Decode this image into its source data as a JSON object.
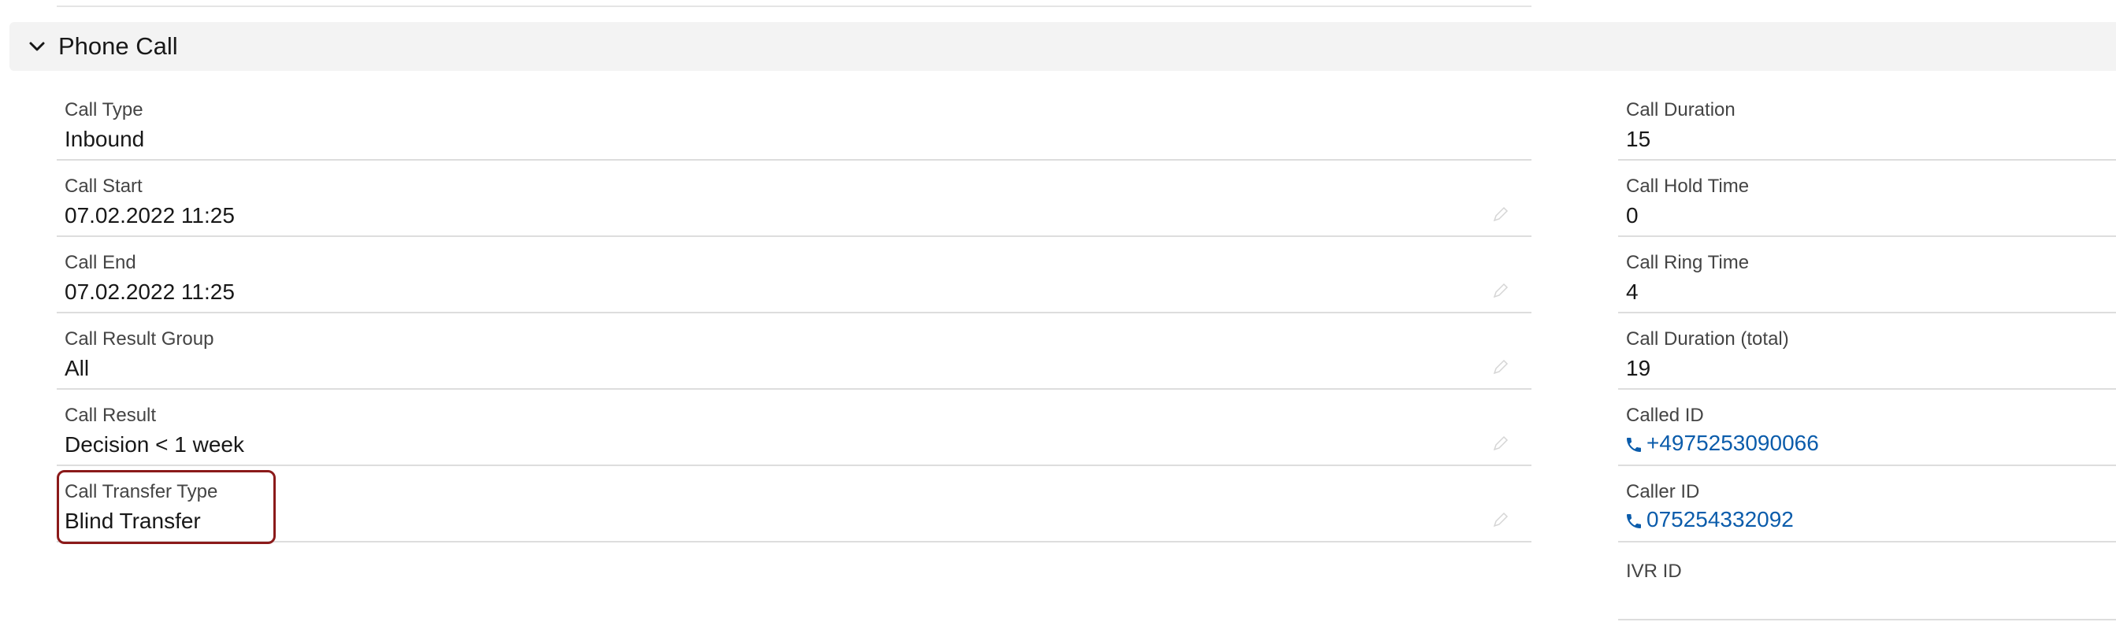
{
  "section": {
    "title": "Phone Call",
    "icon": "chevron-down-icon"
  },
  "left_fields": [
    {
      "label": "Call Type",
      "value": "Inbound",
      "editable": false
    },
    {
      "label": "Call Start",
      "value": "07.02.2022 11:25",
      "editable": true
    },
    {
      "label": "Call End",
      "value": "07.02.2022 11:25",
      "editable": true
    },
    {
      "label": "Call Result Group",
      "value": "All",
      "editable": true
    },
    {
      "label": "Call Result",
      "value": "Decision < 1 week",
      "editable": true
    },
    {
      "label": "Call Transfer Type",
      "value": "Blind Transfer",
      "editable": true
    }
  ],
  "right_fields": [
    {
      "label": "Call Duration",
      "value": "15"
    },
    {
      "label": "Call Hold Time",
      "value": "0"
    },
    {
      "label": "Call Ring Time",
      "value": "4"
    },
    {
      "label": "Call Duration (total)",
      "value": "19"
    },
    {
      "label": "Called ID",
      "value": "+4975253090066",
      "link": true
    },
    {
      "label": "Caller ID",
      "value": "075254332092",
      "link": true
    },
    {
      "label": "IVR ID",
      "value": ""
    }
  ],
  "colors": {
    "link": "#0b5cab",
    "highlight": "#8b1a1a",
    "header_bg": "#f3f3f3"
  }
}
